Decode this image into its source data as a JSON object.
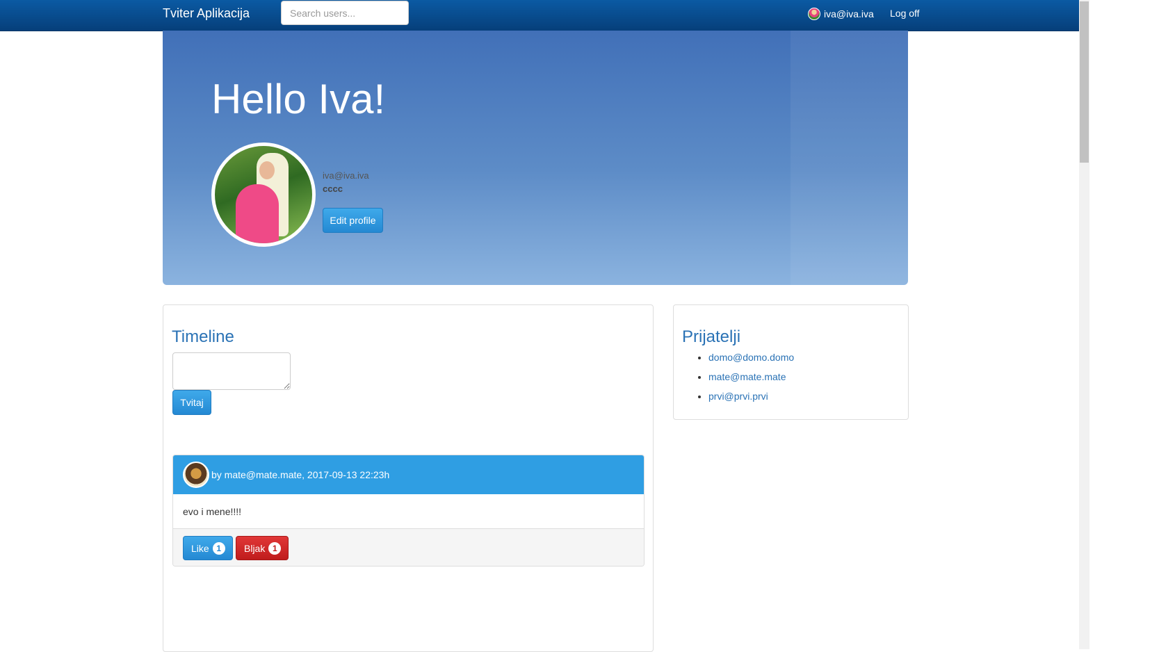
{
  "navbar": {
    "brand": "Tviter Aplikacija",
    "search_placeholder": "Search users...",
    "user_email": "iva@iva.iva",
    "logoff_label": "Log off"
  },
  "hero": {
    "greeting": "Hello Iva!",
    "email": "iva@iva.iva",
    "status": "cccc",
    "edit_label": "Edit profile"
  },
  "timeline": {
    "title": "Timeline",
    "tweet_button": "Tvitaj",
    "posts": [
      {
        "meta": "by mate@mate.mate, 2017-09-13 22:23h",
        "text": "evo i mene!!!!",
        "like_label": "Like",
        "like_count": "1",
        "bljak_label": "Bljak",
        "bljak_count": "1"
      }
    ]
  },
  "friends": {
    "title": "Prijatelji",
    "items": [
      "domo@domo.domo",
      "mate@mate.mate",
      "prvi@prvi.prvi"
    ]
  },
  "colors": {
    "navbar": "#063f7a",
    "primary_button": "#2489d3",
    "danger_button": "#c01c1c",
    "link": "#2a72b5",
    "tweet_header": "#2f9ee3"
  }
}
